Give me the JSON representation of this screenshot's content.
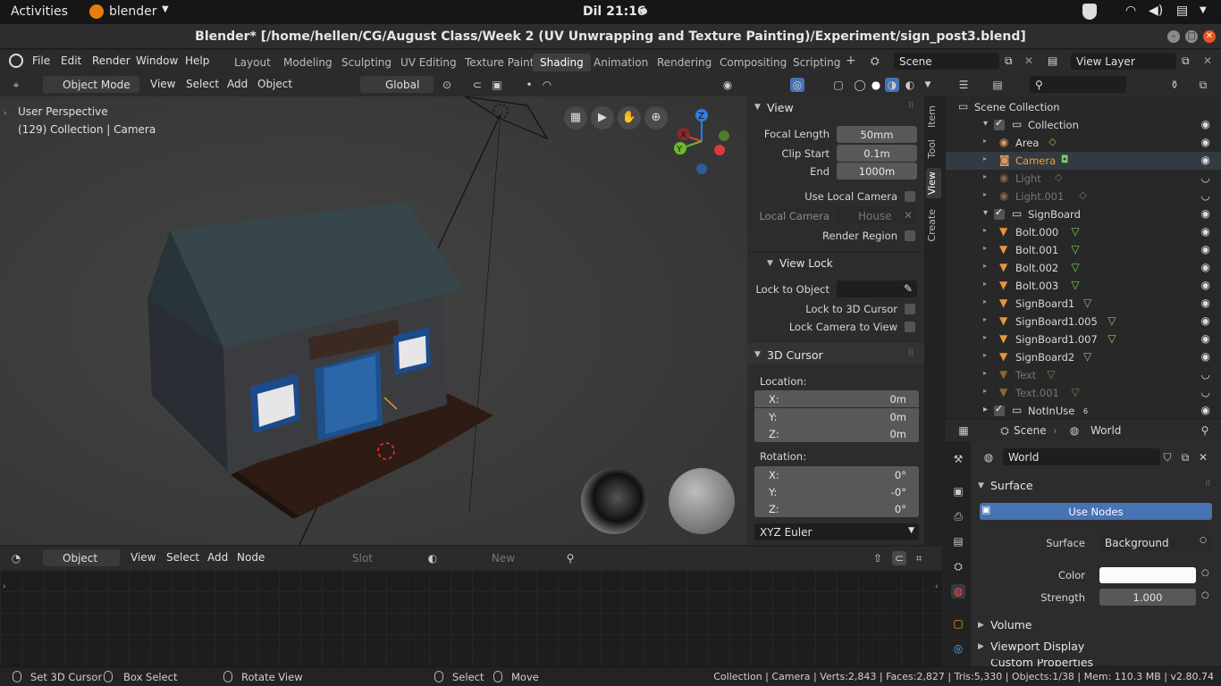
{
  "gnome": {
    "activities": "Activities",
    "app_name": "blender",
    "clock": "Dil 21:16"
  },
  "window": {
    "title": "Blender* [/home/hellen/CG/August Class/Week 2 (UV Unwrapping and Texture Painting)/Experiment/sign_post3.blend]"
  },
  "menu": [
    "File",
    "Edit",
    "Render",
    "Window",
    "Help"
  ],
  "workspaces": [
    "Layout",
    "Modeling",
    "Sculpting",
    "UV Editing",
    "Texture Paint",
    "Shading",
    "Animation",
    "Rendering",
    "Compositing",
    "Scripting"
  ],
  "active_workspace": "Shading",
  "scene_field": "Scene",
  "view_layer_field": "View Layer",
  "viewport_header": {
    "mode": "Object Mode",
    "view": "View",
    "select": "Select",
    "add": "Add",
    "object": "Object",
    "orientation": "Global"
  },
  "viewport": {
    "overlay_line1": "User Perspective",
    "overlay_line2": "(129) Collection | Camera",
    "axis_x": "X",
    "axis_y": "Y",
    "axis_z": "Z"
  },
  "npanel": {
    "tabs": [
      "Item",
      "Tool",
      "View",
      "Create"
    ],
    "active_tab": "View",
    "view_title": "View",
    "focal_length_label": "Focal Length",
    "focal_length": "50mm",
    "clip_start_label": "Clip Start",
    "clip_start": "0.1m",
    "end_label": "End",
    "end": "1000m",
    "use_local_camera": "Use Local Camera",
    "local_camera_label": "Local Camera",
    "local_camera_value": "House",
    "render_region": "Render Region",
    "view_lock_title": "View Lock",
    "lock_to_object": "Lock to Object",
    "lock_to_3d_cursor": "Lock to 3D Cursor",
    "lock_camera_to_view": "Lock Camera to View",
    "cursor_title": "3D Cursor",
    "location_label": "Location:",
    "loc": [
      {
        "axis": "X:",
        "value": "0m"
      },
      {
        "axis": "Y:",
        "value": "0m"
      },
      {
        "axis": "Z:",
        "value": "0m"
      }
    ],
    "rotation_label": "Rotation:",
    "rot": [
      {
        "axis": "X:",
        "value": "0°"
      },
      {
        "axis": "Y:",
        "value": "-0°"
      },
      {
        "axis": "Z:",
        "value": "0°"
      }
    ],
    "rotation_mode": "XYZ Euler"
  },
  "node_header": {
    "object": "Object",
    "view": "View",
    "select": "Select",
    "add": "Add",
    "node": "Node",
    "slot": "Slot",
    "new": "New"
  },
  "outliner": {
    "search_placeholder": "",
    "rows": [
      {
        "label": "Scene Collection",
        "indent": 0,
        "icon": "scene-collection-icon",
        "color": "#d8d8d8",
        "eye": ""
      },
      {
        "label": "Collection",
        "indent": 1,
        "icon": "collection-icon",
        "color": "#d8d8d8",
        "eye": "◉",
        "expand": "▾",
        "check": true
      },
      {
        "label": "Area",
        "indent": 2,
        "icon": "light-icon",
        "color": "#d8d8d8",
        "eye": "◉"
      },
      {
        "label": "Camera",
        "indent": 2,
        "icon": "camera-icon",
        "color": "#f0a030",
        "eye": "◉"
      },
      {
        "label": "Light",
        "indent": 2,
        "icon": "light-icon",
        "color": "#777",
        "eye": "◡"
      },
      {
        "label": "Light.001",
        "indent": 2,
        "icon": "light-icon",
        "color": "#777",
        "eye": "◡"
      },
      {
        "label": "SignBoard",
        "indent": 1,
        "icon": "collection-icon",
        "color": "#d8d8d8",
        "eye": "◉",
        "expand": "▾",
        "check": true
      },
      {
        "label": "Bolt.000",
        "indent": 2,
        "icon": "mesh-icon",
        "color": "#d8d8d8",
        "eye": "◉"
      },
      {
        "label": "Bolt.001",
        "indent": 2,
        "icon": "mesh-icon",
        "color": "#d8d8d8",
        "eye": "◉"
      },
      {
        "label": "Bolt.002",
        "indent": 2,
        "icon": "mesh-icon",
        "color": "#d8d8d8",
        "eye": "◉"
      },
      {
        "label": "Bolt.003",
        "indent": 2,
        "icon": "mesh-icon",
        "color": "#d8d8d8",
        "eye": "◉"
      },
      {
        "label": "SignBoard1",
        "indent": 2,
        "icon": "mesh-icon",
        "color": "#d8d8d8",
        "eye": "◉"
      },
      {
        "label": "SignBoard1.005",
        "indent": 2,
        "icon": "mesh-icon",
        "color": "#d8d8d8",
        "eye": "◉"
      },
      {
        "label": "SignBoard1.007",
        "indent": 2,
        "icon": "mesh-icon",
        "color": "#d8d8d8",
        "eye": "◉"
      },
      {
        "label": "SignBoard2",
        "indent": 2,
        "icon": "mesh-icon",
        "color": "#d8d8d8",
        "eye": "◉"
      },
      {
        "label": "Text",
        "indent": 2,
        "icon": "mesh-icon",
        "color": "#777",
        "eye": "◡"
      },
      {
        "label": "Text.001",
        "indent": 2,
        "icon": "mesh-icon",
        "color": "#777",
        "eye": "◡"
      },
      {
        "label": "NotInUse",
        "indent": 1,
        "icon": "collection-icon",
        "color": "#d8d8d8",
        "eye": "◉",
        "expand": "▸",
        "check": true
      }
    ],
    "notinuse_count": "6"
  },
  "props": {
    "scene_tab": "Scene",
    "world_tab": "World",
    "world_name": "World",
    "surface_title": "Surface",
    "use_nodes": "Use Nodes",
    "surface_label": "Surface",
    "surface_value": "Background",
    "color_label": "Color",
    "strength_label": "Strength",
    "strength_value": "1.000",
    "volume_title": "Volume",
    "viewport_display_title": "Viewport Display",
    "custom_props_title": "Custom Properties"
  },
  "status": {
    "set_cursor": "Set 3D Cursor",
    "box_select": "Box Select",
    "rotate_view": "Rotate View",
    "select": "Select",
    "move": "Move",
    "stats": "Collection | Camera | Verts:2,843 | Faces:2,827 | Tris:5,330 | Objects:1/38 | Mem: 110.3 MB | v2.80.74"
  },
  "colors": {
    "accent": "#4772b3",
    "active_orange": "#f0a030"
  }
}
